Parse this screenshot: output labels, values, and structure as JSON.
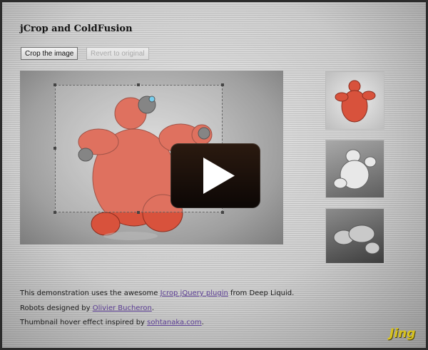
{
  "page": {
    "title": "jCrop and ColdFusion"
  },
  "toolbar": {
    "crop_label": "Crop the image",
    "revert_label": "Revert to original"
  },
  "footer": {
    "line1": {
      "before": "This demonstration uses the awesome ",
      "link": "Jcrop jQuery plugin",
      "after": " from Deep Liquid."
    },
    "line2": {
      "before": "Robots designed by ",
      "link": "Olivier Bucheron",
      "after": "."
    },
    "line3": {
      "before": "Thumbnail hover effect inspired by ",
      "link": "sohtanaka.com",
      "after": "."
    }
  },
  "watermark": {
    "text": "Jing"
  },
  "thumbnails": [
    "red-robot",
    "white-robot",
    "gray-robot"
  ],
  "icons": {
    "play": "play-icon"
  },
  "colors": {
    "link": "#5b3d94",
    "robot_red": "#d8523c",
    "jing_yellow": "#d7c21e"
  }
}
